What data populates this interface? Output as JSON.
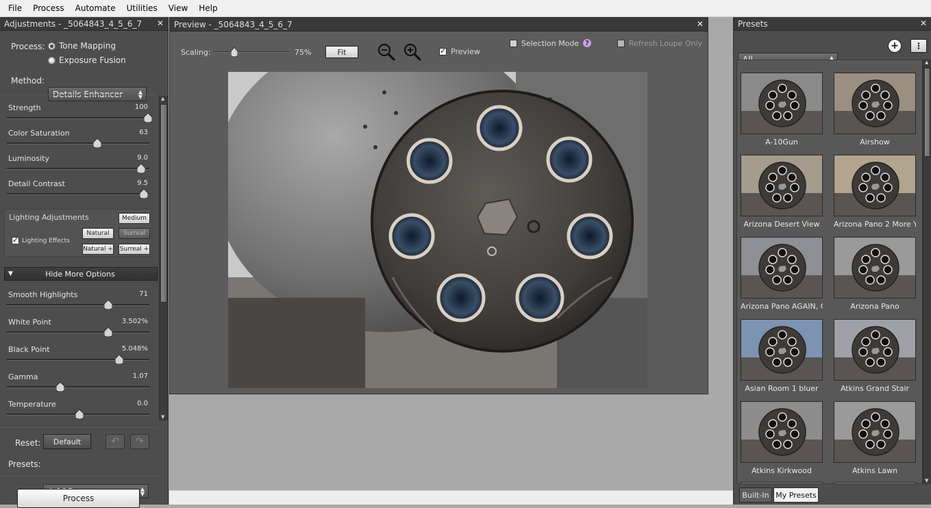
{
  "menu": [
    "File",
    "Process",
    "Automate",
    "Utilities",
    "View",
    "Help"
  ],
  "adjustments": {
    "title": "Adjustments - _5064843_4_5_6_7",
    "process_label": "Process:",
    "process_options": [
      "Tone Mapping",
      "Exposure Fusion"
    ],
    "method_label": "Method:",
    "method_value": "Details Enhancer",
    "sliders_a": [
      {
        "name": "Strength",
        "value": "100",
        "level": 1.0
      },
      {
        "name": "Color Saturation",
        "value": "63",
        "level": 0.63
      },
      {
        "name": "Luminosity",
        "value": "9.0",
        "level": 0.95
      },
      {
        "name": "Detail Contrast",
        "value": "9.5",
        "level": 0.97
      }
    ],
    "lighting": {
      "title": "Lighting Adjustments",
      "effects_label": "Lighting Effects",
      "buttons": [
        "Medium",
        "Natural",
        "Surreal",
        "Natural +",
        "Surreal +"
      ]
    },
    "hide_more": "Hide More Options",
    "sliders_b": [
      {
        "name": "Smooth Highlights",
        "value": "71",
        "level": 0.71
      },
      {
        "name": "White Point",
        "value": "3.502%",
        "level": 0.71
      },
      {
        "name": "Black Point",
        "value": "5.048%",
        "level": 0.79
      },
      {
        "name": "Gamma",
        "value": "1.07",
        "level": 0.36
      },
      {
        "name": "Temperature",
        "value": "0.0",
        "level": 0.5
      }
    ],
    "reset_label": "Reset:",
    "default_button": "Default",
    "presets_label": "Presets:",
    "presets_value": "A-10Gun",
    "process_button": "Process"
  },
  "preview": {
    "title": "Preview - _5064843_4_5_6_7",
    "scaling_label": "Scaling:",
    "scaling_value": "75%",
    "scaling_level": 0.25,
    "fit_button": "Fit",
    "preview_label": "Preview",
    "selection_mode_label": "Selection Mode",
    "refresh_loupe_label": "Refresh Loupe Only"
  },
  "presets": {
    "title": "Presets",
    "filter": "All",
    "items": [
      "A-10Gun",
      "Airshow",
      "Arizona Desert View",
      "Arizona Pano 2 More Y",
      "Arizona Pano AGAIN, C",
      "Arizona Pano",
      "Asian Room 1 bluer",
      "Atkins Grand Stair",
      "Atkins Kirkwood",
      "Atkins Lawn"
    ],
    "tabs": [
      "Built-In",
      "My Presets"
    ]
  },
  "colors": {
    "panel": "#4d4d4d",
    "title_bar": "#3a3a3a",
    "workspace": "#a9a9a9"
  }
}
